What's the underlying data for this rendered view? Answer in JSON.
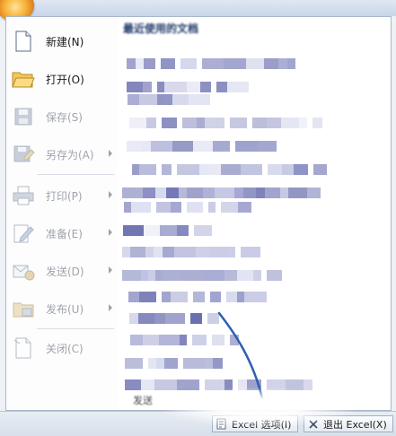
{
  "menu": {
    "items": [
      {
        "label": "新建(N)",
        "icon": "new-document-icon",
        "enabled": true,
        "submenu": false
      },
      {
        "label": "打开(O)",
        "icon": "open-folder-icon",
        "enabled": true,
        "submenu": false
      },
      {
        "label": "保存(S)",
        "icon": "save-disk-icon",
        "enabled": false,
        "submenu": false
      },
      {
        "label": "另存为(A)",
        "icon": "save-as-icon",
        "enabled": false,
        "submenu": true
      },
      {
        "label": "打印(P)",
        "icon": "printer-icon",
        "enabled": false,
        "submenu": true
      },
      {
        "label": "准备(E)",
        "icon": "prepare-pen-icon",
        "enabled": false,
        "submenu": true
      },
      {
        "label": "发送(D)",
        "icon": "send-icon",
        "enabled": false,
        "submenu": true
      },
      {
        "label": "发布(U)",
        "icon": "publish-icon",
        "enabled": false,
        "submenu": true
      },
      {
        "label": "关闭(C)",
        "icon": "close-document-icon",
        "enabled": false,
        "submenu": false
      }
    ]
  },
  "recent": {
    "title": "最近使用的文档",
    "row_colors": [
      "#8e93c4",
      "#a7aad2",
      "#7478b4",
      "#c5c7e3",
      "#6a6fae",
      "#b2b5dc",
      "#8388c0",
      "#d2d4ec",
      "#9ea2cf",
      "#7c80b9",
      "#e0e2f2",
      "#5c63a8"
    ]
  },
  "footer": {
    "options_label": "Excel 选项(I)",
    "exit_label": "退出 Excel(X)",
    "partial_label": "发送"
  },
  "colors": {
    "orb": "#f2a83b",
    "annotation_line": "#2f5fb0"
  }
}
